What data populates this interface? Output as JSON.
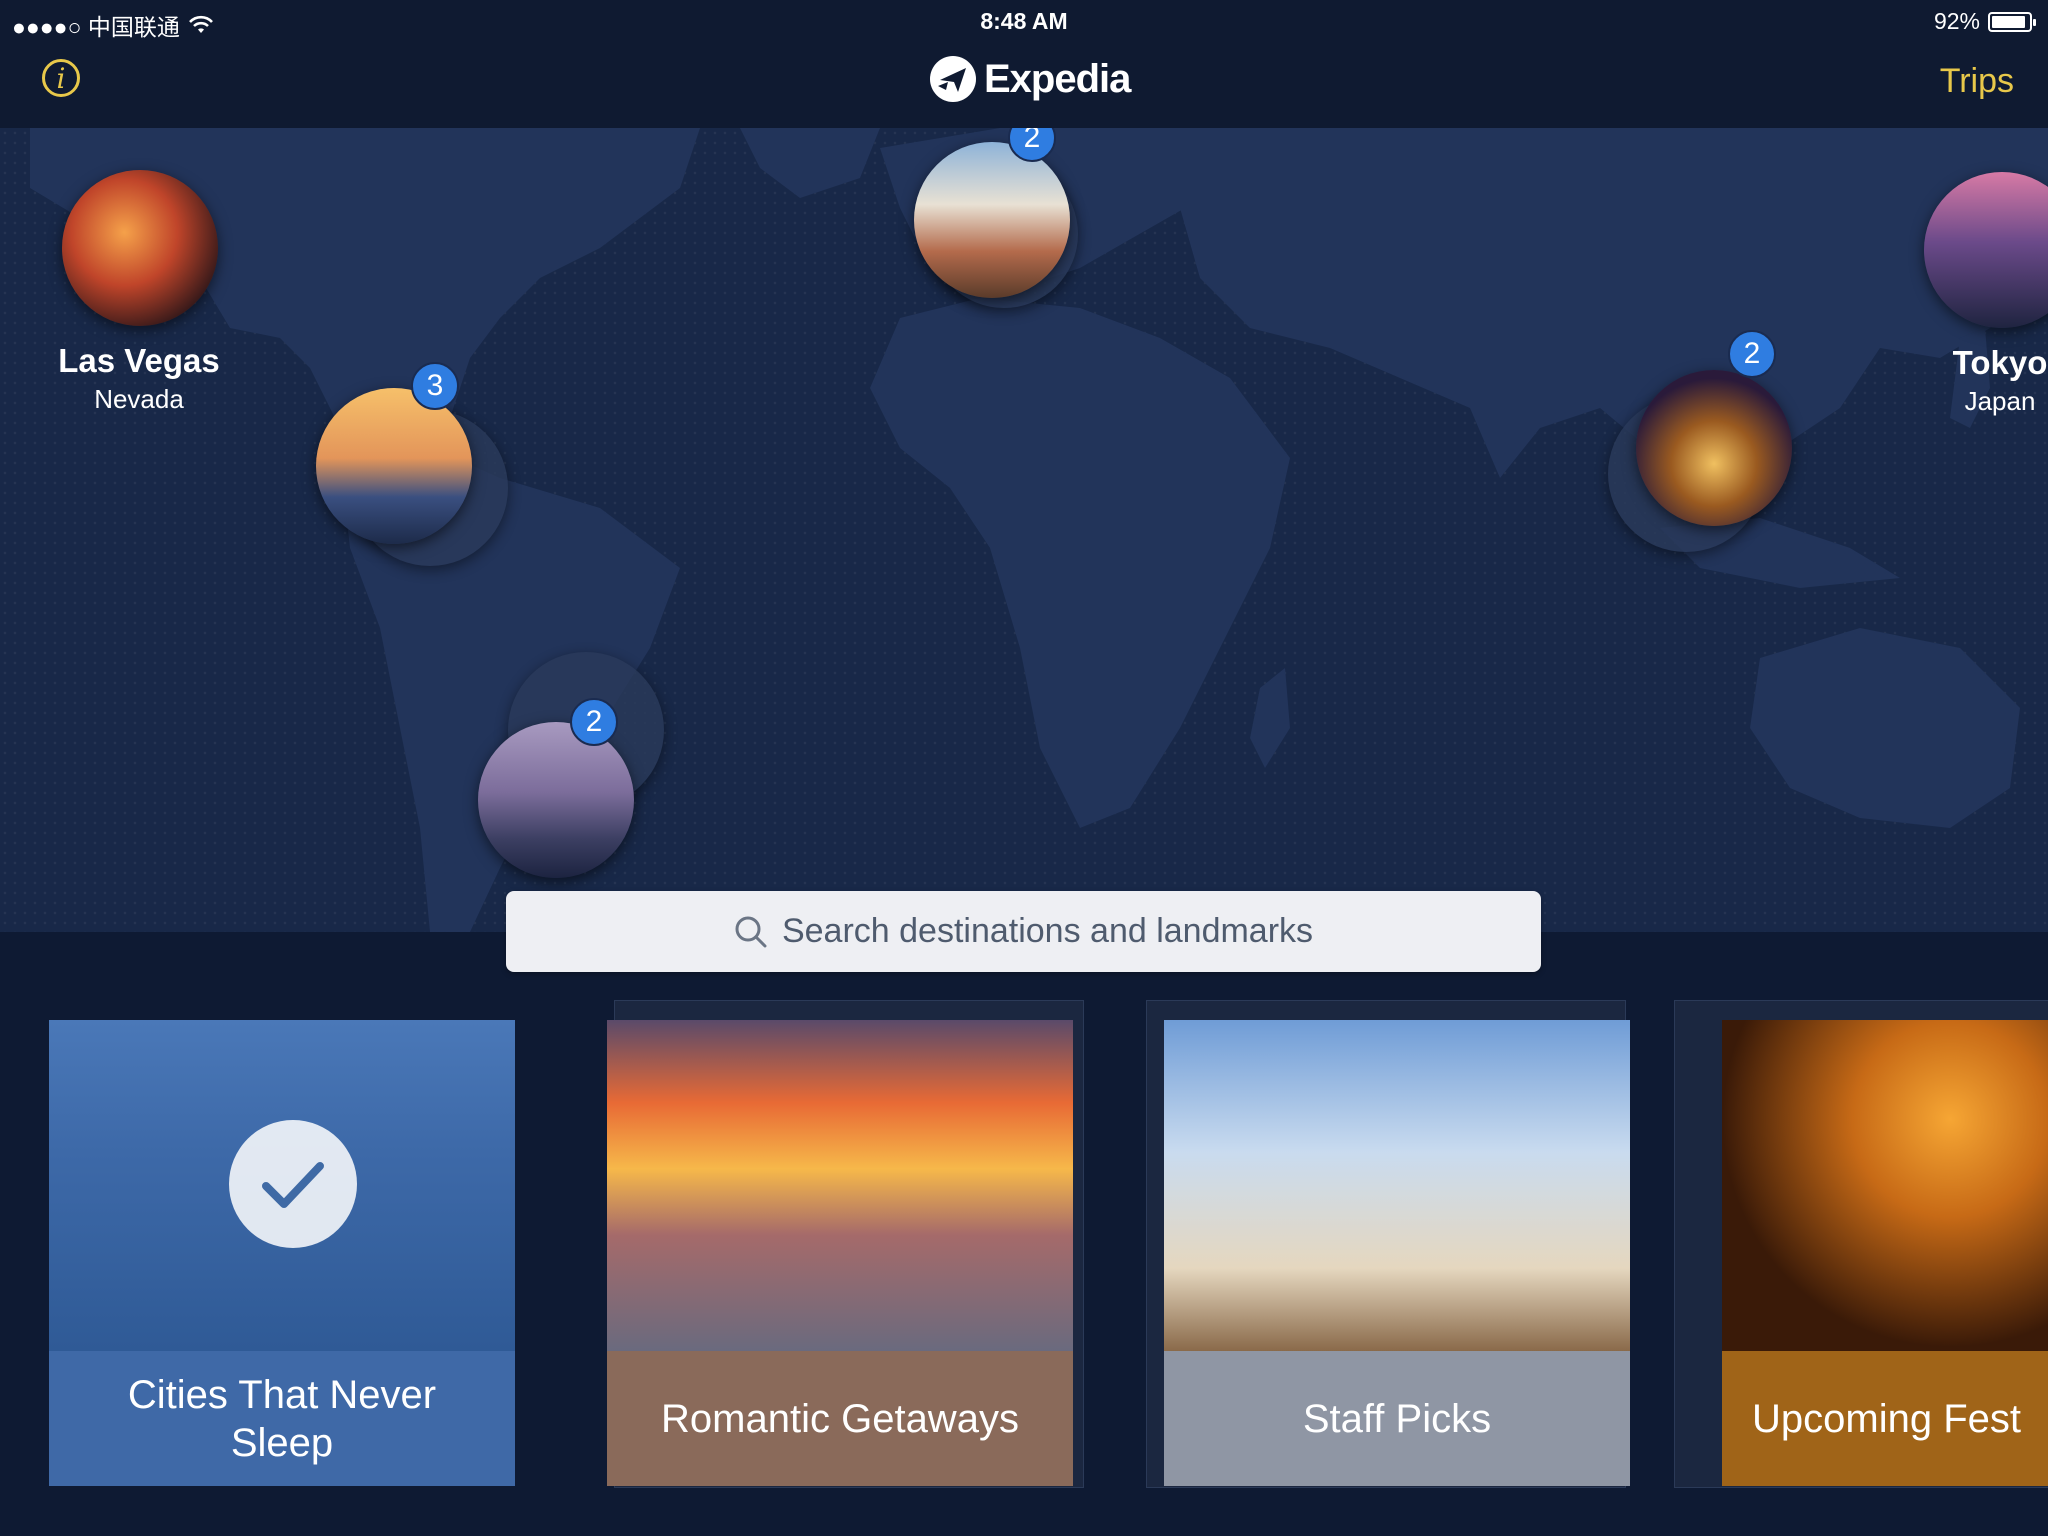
{
  "status_bar": {
    "carrier": "●●●●○ 中国联通",
    "time": "8:48 AM",
    "battery_text": "92%",
    "battery_level": 0.92
  },
  "nav": {
    "info_icon": "info-icon",
    "logo_text": "Expedia",
    "trips_label": "Trips",
    "accent_color": "#e8c84a"
  },
  "map": {
    "pins": [
      {
        "city": "Las Vegas",
        "region": "Nevada",
        "badge": ""
      },
      {
        "city": "",
        "region": "",
        "badge": "3"
      },
      {
        "city": "",
        "region": "",
        "badge": "2"
      },
      {
        "city": "",
        "region": "",
        "badge": "2"
      },
      {
        "city": "Tokyo",
        "region": "Japan",
        "badge": ""
      },
      {
        "city": "",
        "region": "",
        "badge": "2"
      }
    ],
    "badge_color": "#2f7de1"
  },
  "search": {
    "placeholder": "Search destinations and landmarks"
  },
  "categories": [
    {
      "label": "Cities That Never Sleep",
      "selected": true
    },
    {
      "label": "Romantic Getaways",
      "selected": false
    },
    {
      "label": "Staff Picks",
      "selected": false
    },
    {
      "label": "Upcoming Fest",
      "selected": false
    }
  ]
}
